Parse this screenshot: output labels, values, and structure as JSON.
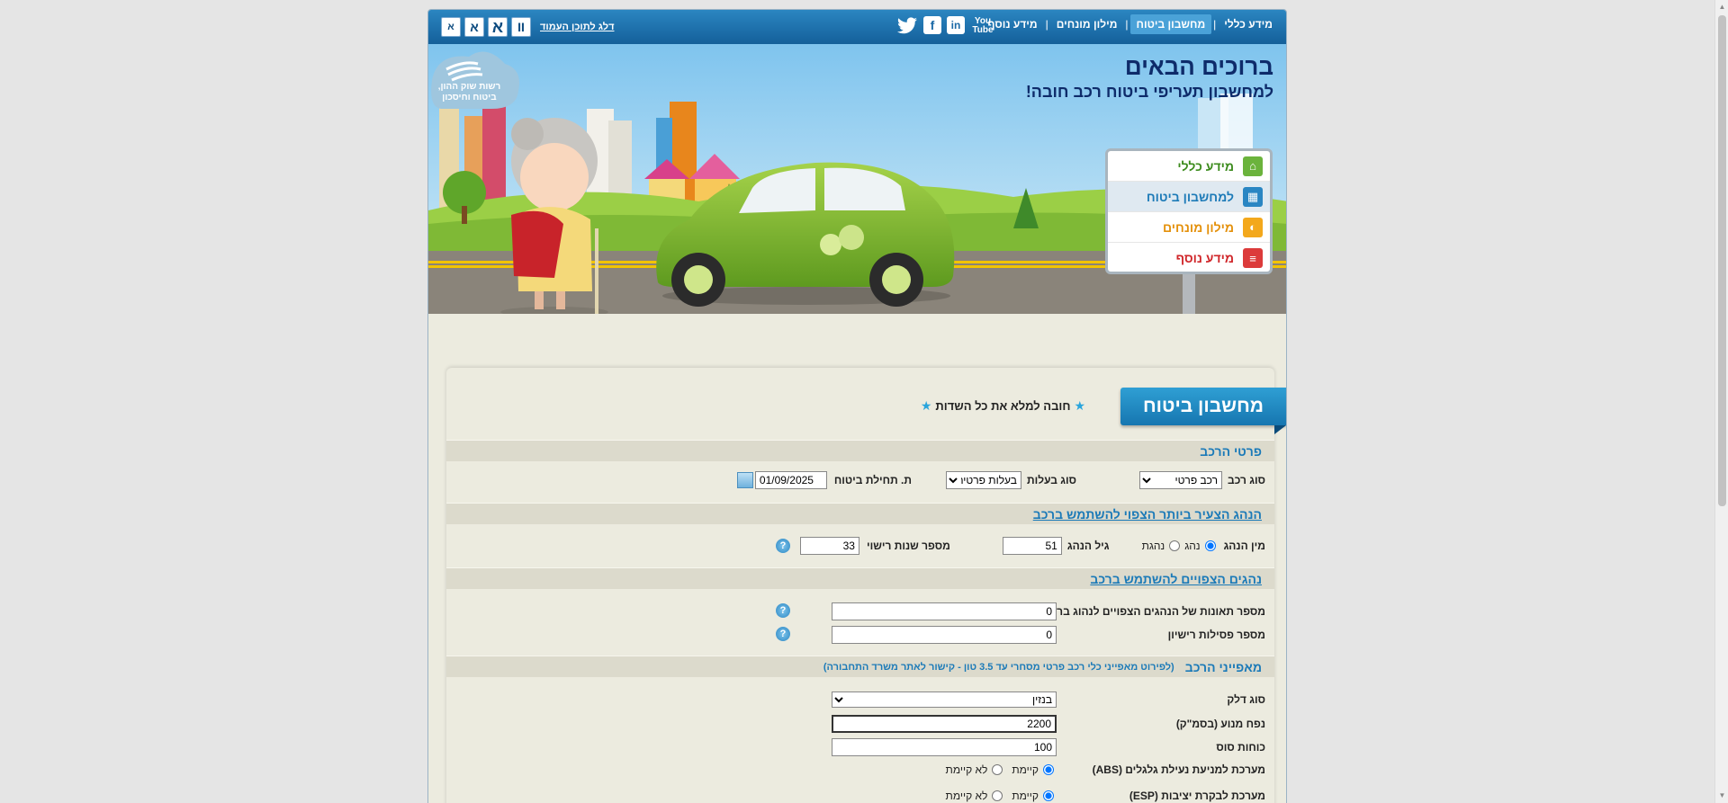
{
  "topnav": {
    "items": [
      "מידע כללי",
      "מחשבון ביטוח",
      "מילון מונחים",
      "מידע נוסף"
    ],
    "active_index": 1
  },
  "social": {
    "youtube": "You Tube",
    "linkedin": "in",
    "facebook": "f",
    "twitter": "t"
  },
  "accessibility": {
    "skip_link": "דלג לתוכן העמוד",
    "pause": "II",
    "font_large": "א",
    "font_medium": "א",
    "font_small": "א"
  },
  "hero": {
    "title": "ברוכים הבאים",
    "subtitle": "למחשבון תעריפי ביטוח רכב חובה!",
    "logo_text": "רשות שוק ההון, ביטוח וחיסכון"
  },
  "side_menu": [
    {
      "label": "מידע כללי",
      "icon": "home-icon",
      "color": "#3d8c1e",
      "icon_bg": "#6bb33c"
    },
    {
      "label": "למחשבון ביטוח",
      "icon": "calculator-icon",
      "color": "#1e7bb8",
      "icon_bg": "#2a86c3"
    },
    {
      "label": "מילון מונחים",
      "icon": "book-icon",
      "color": "#e4910c",
      "icon_bg": "#f3a81c"
    },
    {
      "label": "מידע נוסף",
      "icon": "document-icon",
      "color": "#d0262a",
      "icon_bg": "#dc3b3b"
    }
  ],
  "calc": {
    "tab_title": "מחשבון ביטוח",
    "required_note": "חובה למלא את כל השדות"
  },
  "vehicle": {
    "section_title": "פרטי הרכב",
    "vehicle_type_label": "סוג רכב",
    "vehicle_type_value": "רכב פרטי",
    "ownership_label": "סוג בעלות",
    "ownership_value": "בעלות פרטית",
    "start_date_label": "ת. תחילת ביטוח",
    "start_date_value": "01/09/2025"
  },
  "young_driver": {
    "section_title": "הנהג הצעיר ביותר הצפוי להשתמש ברכב",
    "gender_label": "מין הנהג",
    "gender_male": "נהג",
    "gender_female": "נהגת",
    "age_label": "גיל הנהג",
    "age_value": "51",
    "license_years_label": "מספר שנות רישוי",
    "license_years_value": "33"
  },
  "drivers": {
    "section_title": "נהגים הצפויים להשתמש ברכב",
    "accidents_label": "מספר תאונות של הנהגים הצפויים לנהוג ברכב",
    "accidents_value": "0",
    "revocations_label": "מספר פסילות רישיון",
    "revocations_value": "0"
  },
  "features": {
    "section_title": "מאפייני הרכב",
    "section_note": "(לפירוט מאפייני כלי רכב פרטי מסחרי עד 3.5 טון - קישור לאתר משרד התחבורה)",
    "fuel_label": "סוג דלק",
    "fuel_value": "בנזין",
    "engine_label": "נפח מנוע (בסמ\"ק)",
    "engine_value": "2200",
    "hp_label": "כוחות סוס",
    "hp_value": "100",
    "abs_label": "מערכת למניעת נעילת גלגלים (ABS)",
    "esp_label": "מערכת לבקרת יציבות (ESP)",
    "exists": "קיימת",
    "not_exists": "לא קיימת"
  },
  "help_icon_glyph": "?"
}
